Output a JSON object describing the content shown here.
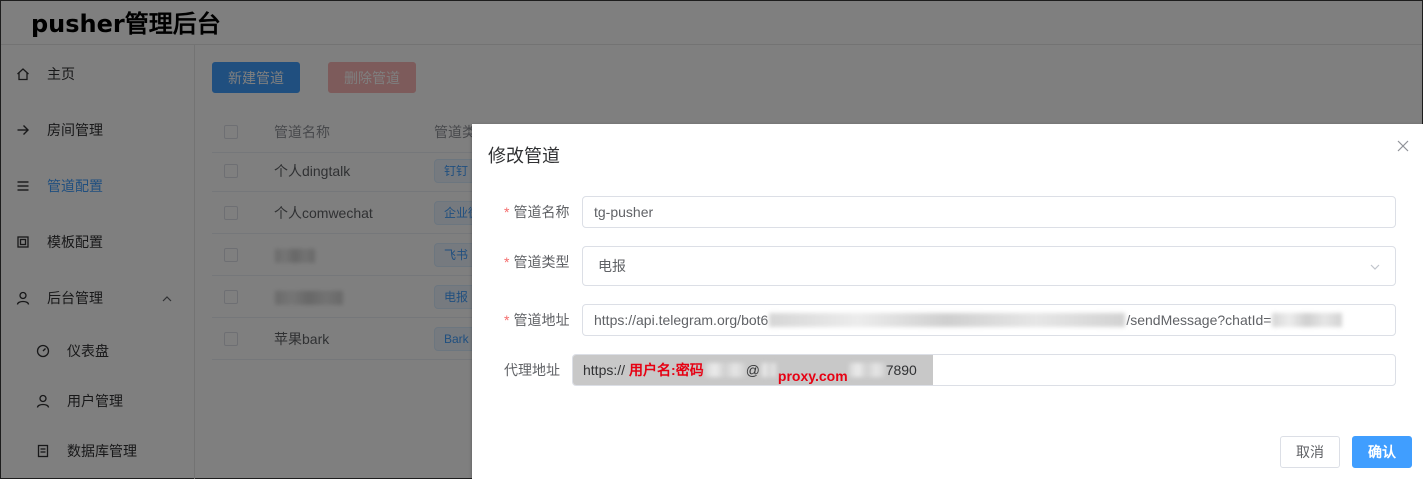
{
  "app": {
    "title": "pusher管理后台"
  },
  "sidebar": {
    "items": [
      {
        "label": "主页",
        "icon": "home-icon"
      },
      {
        "label": "房间管理",
        "icon": "arrow-right-icon"
      },
      {
        "label": "管道配置",
        "icon": "list-icon",
        "active": true
      },
      {
        "label": "模板配置",
        "icon": "template-icon"
      },
      {
        "label": "后台管理",
        "icon": "user-icon",
        "expanded": true
      }
    ],
    "subitems": [
      {
        "label": "仪表盘",
        "icon": "dashboard-icon"
      },
      {
        "label": "用户管理",
        "icon": "user-icon"
      },
      {
        "label": "数据库管理",
        "icon": "database-icon"
      }
    ]
  },
  "toolbar": {
    "new_label": "新建管道",
    "delete_label": "删除管道"
  },
  "table": {
    "headers": {
      "name": "管道名称",
      "type": "管道类型"
    },
    "rows": [
      {
        "name": "个人dingtalk",
        "type": "钉钉",
        "blurred": false
      },
      {
        "name": "个人comwechat",
        "type": "企业微信",
        "blurred": false
      },
      {
        "name": "",
        "type": "飞书",
        "blurred": true
      },
      {
        "name": "",
        "type": "电报",
        "blurred": true
      },
      {
        "name": "苹果bark",
        "type": "Bark",
        "blurred": false
      }
    ]
  },
  "dialog": {
    "title": "修改管道",
    "fields": {
      "name": {
        "label": "管道名称",
        "value": "tg-pusher",
        "required": true
      },
      "type": {
        "label": "管道类型",
        "value": "电报",
        "required": true
      },
      "url": {
        "label": "管道地址",
        "prefix": "https://api.telegram.org/bot6",
        "suffix": "/sendMessage?chatId=",
        "required": true
      },
      "proxy": {
        "label": "代理地址",
        "prefix": "https://",
        "annotation_user": "用户名:密码",
        "at": "@",
        "annotation_host": "proxy.com",
        "port": "7890",
        "required": false
      }
    },
    "cancel_label": "取消",
    "confirm_label": "确认"
  },
  "colors": {
    "primary": "#409eff",
    "danger_disabled": "#fab6b6",
    "required": "#f56c6c",
    "annotation": "#e60012"
  }
}
